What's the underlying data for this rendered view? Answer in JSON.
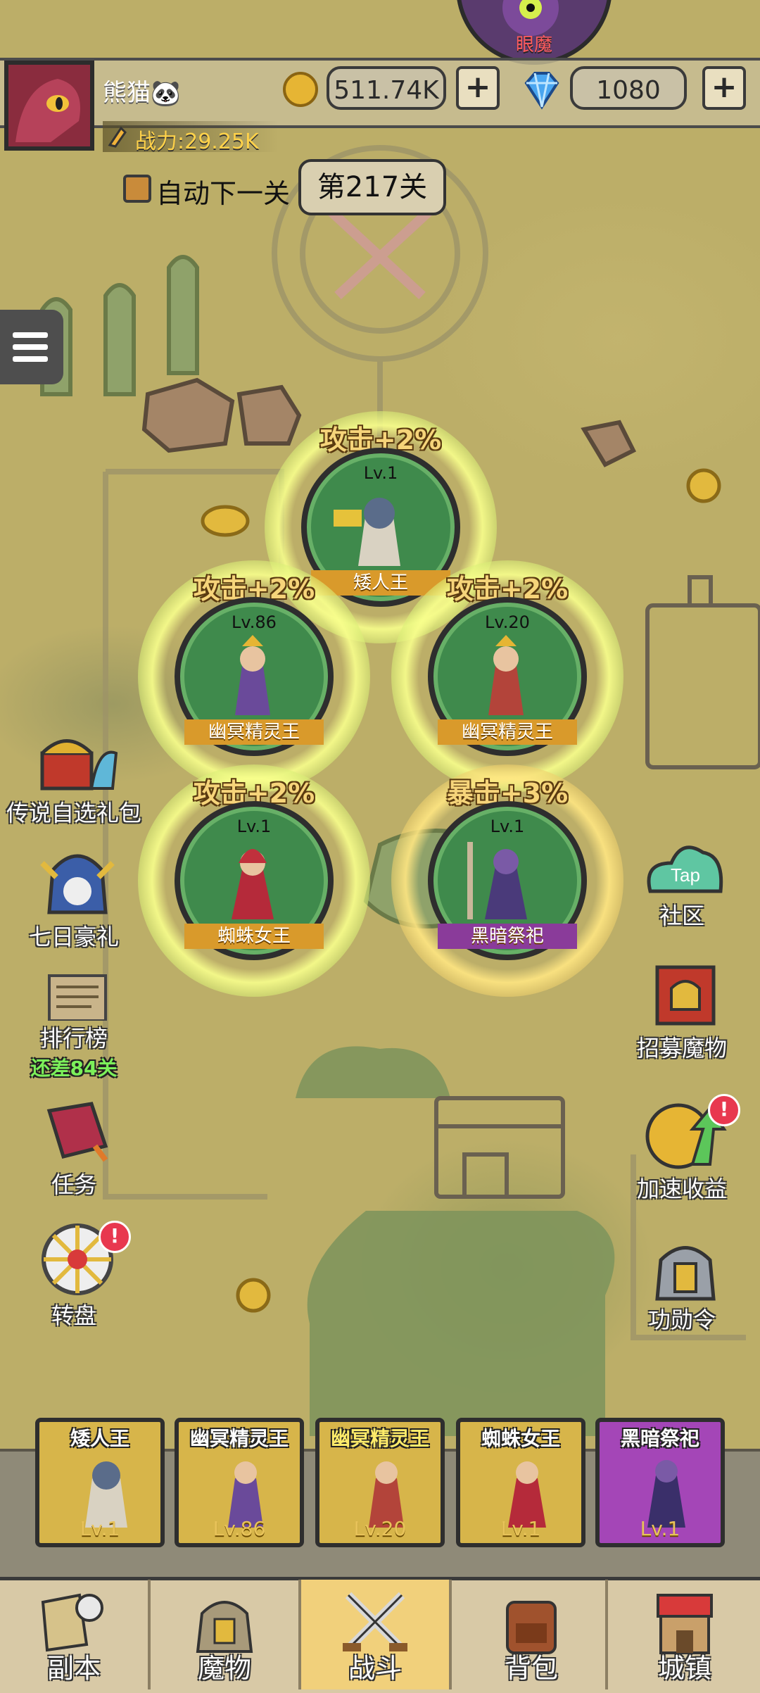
{
  "boss": {
    "name": "眼魔"
  },
  "player": {
    "name": "熊猫🐼",
    "power": "战力:29.25K"
  },
  "currency": {
    "coins": "511.74K",
    "gems": "1080",
    "plus_label": "+"
  },
  "battle": {
    "auto_next_label": "自动下一关",
    "stage_label": "第217关"
  },
  "formation": [
    {
      "bonus": "攻击+2%",
      "level": "Lv.1",
      "name": "矮人王",
      "ring": "green"
    },
    {
      "bonus": "攻击+2%",
      "level": "Lv.86",
      "name": "幽冥精灵王",
      "ring": "green"
    },
    {
      "bonus": "攻击+2%",
      "level": "Lv.20",
      "name": "幽冥精灵王",
      "ring": "green"
    },
    {
      "bonus": "攻击+2%",
      "level": "Lv.1",
      "name": "蜘蛛女王",
      "ring": "green"
    },
    {
      "bonus": "暴击+3%",
      "level": "Lv.1",
      "name": "黑暗祭祀",
      "ring": "gold"
    }
  ],
  "left_menu": [
    {
      "label": "传说自选礼包",
      "icon": "treasure-chest-icon"
    },
    {
      "label": "七日豪礼",
      "icon": "knight-helmet-icon"
    },
    {
      "label": "排行榜",
      "sub": "还差84关",
      "icon": "scroll-icon"
    },
    {
      "label": "任务",
      "icon": "book-icon"
    },
    {
      "label": "转盘",
      "icon": "wheel-icon",
      "badge": "!"
    }
  ],
  "right_menu": [
    {
      "label": "社区",
      "icon": "tap-cloud-icon",
      "icon_text": "Tap"
    },
    {
      "label": "招募魔物",
      "icon": "banner-helmet-icon"
    },
    {
      "label": "加速收益",
      "icon": "coin-arrow-icon",
      "badge": "!"
    },
    {
      "label": "功勋令",
      "icon": "helmet-medal-icon"
    }
  ],
  "team": [
    {
      "name": "矮人王",
      "level": "Lv.1",
      "rarity": "gold"
    },
    {
      "name": "幽冥精灵王",
      "level": "Lv.86",
      "rarity": "gold"
    },
    {
      "name": "幽冥精灵王",
      "level": "Lv.20",
      "rarity": "gold"
    },
    {
      "name": "蜘蛛女王",
      "level": "Lv.1",
      "rarity": "gold"
    },
    {
      "name": "黑暗祭祀",
      "level": "Lv.1",
      "rarity": "purple"
    }
  ],
  "nav": [
    {
      "label": "副本",
      "icon": "map-compass-icon"
    },
    {
      "label": "魔物",
      "icon": "monster-helmet-icon"
    },
    {
      "label": "战斗",
      "icon": "crossed-swords-icon",
      "active": true
    },
    {
      "label": "背包",
      "icon": "backpack-icon"
    },
    {
      "label": "城镇",
      "icon": "shop-icon"
    }
  ],
  "colors": {
    "map": "#bcae68",
    "slot_green": "#3f8a4c",
    "bonus_text": "#f6d47a",
    "active_tab": "#f1d07b",
    "badge": "#e8384f"
  }
}
